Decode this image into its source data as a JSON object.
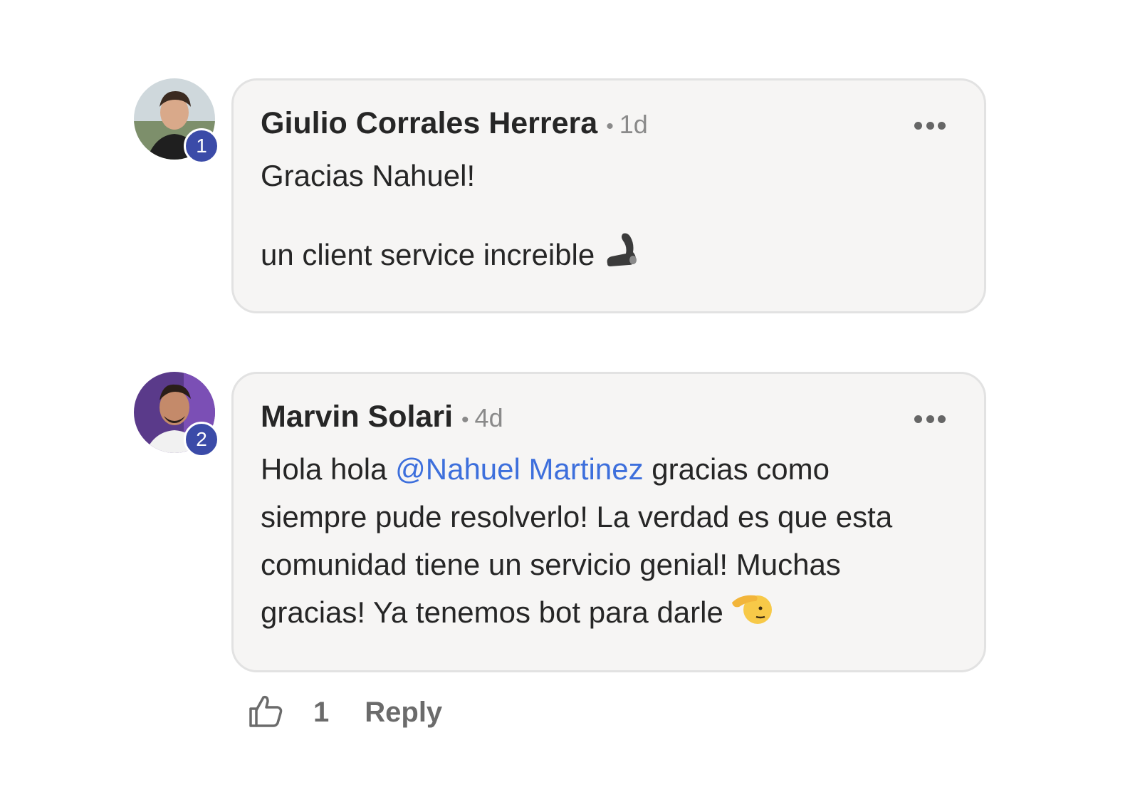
{
  "comments": [
    {
      "author": "Giulio Corrales Herrera",
      "separator": "•",
      "time": "1d",
      "level": "1",
      "text_line_1": "Gracias Nahuel!",
      "text_line_2": "un client service increible",
      "emoji": "flexed-biceps-icon"
    },
    {
      "author": "Marvin Solari",
      "separator": "•",
      "time": "4d",
      "level": "2",
      "text_before_mention": "Hola hola ",
      "mention": "@Nahuel Martinez",
      "text_after_mention": " gracias como siempre pude resolverlo! La verdad es que esta comunidad tiene un servicio genial! Muchas gracias! Ya tenemos bot para darle",
      "emoji": "saluting-face-icon"
    }
  ],
  "actions": {
    "like_count": "1",
    "reply_label": "Reply"
  },
  "colors": {
    "badge": "#3b4ba8",
    "mention": "#3d6fdc",
    "bubble_bg": "#f6f5f4",
    "bubble_border": "#e2e2e2"
  }
}
